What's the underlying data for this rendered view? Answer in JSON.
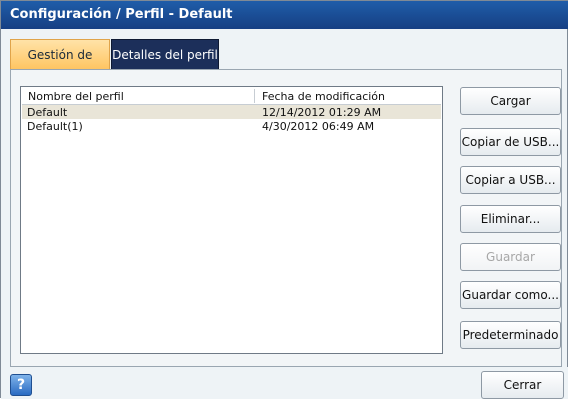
{
  "window": {
    "title": "Configuración / Perfil - Default"
  },
  "tabs": [
    {
      "label": "Gestión de perfil",
      "active": true
    },
    {
      "label": "Detalles del perfil",
      "active": false
    }
  ],
  "profile_list": {
    "columns": [
      "Nombre del perfil",
      "Fecha de modificación"
    ],
    "rows": [
      {
        "name": "Default",
        "date": "12/14/2012 01:29 AM",
        "selected": true
      },
      {
        "name": "Default(1)",
        "date": "4/30/2012 06:49 AM",
        "selected": false
      }
    ]
  },
  "buttons": {
    "load": "Cargar",
    "copy_from_usb": "Copiar de USB...",
    "copy_to_usb": "Copiar a USB...",
    "delete": "Eliminar...",
    "save": "Guardar",
    "save_as": "Guardar como...",
    "default": "Predeterminado"
  },
  "footer": {
    "help_icon": "?",
    "close": "Cerrar"
  }
}
